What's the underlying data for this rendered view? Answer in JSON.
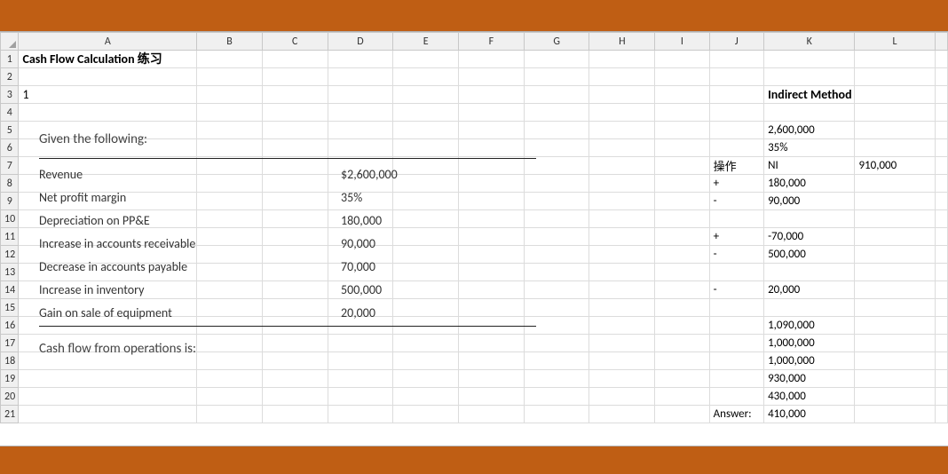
{
  "columns": [
    "A",
    "B",
    "C",
    "D",
    "E",
    "F",
    "G",
    "H",
    "I",
    "J",
    "K",
    "L"
  ],
  "title": "Cash Flow Calculation 练习",
  "heading_num": "1",
  "indirect_label": "Indirect Method",
  "q_heading": "Given the following:",
  "q_rows": [
    {
      "label": "Revenue",
      "value": "$2,600,000"
    },
    {
      "label": "Net profit margin",
      "value": "35%"
    },
    {
      "label": "Depreciation on PP&E",
      "value": "180,000"
    },
    {
      "label": "Increase in accounts receivable",
      "value": "90,000"
    },
    {
      "label": "Decrease in accounts payable",
      "value": "70,000"
    },
    {
      "label": "Increase in inventory",
      "value": "500,000"
    },
    {
      "label": "Gain on sale of equipment",
      "value": "20,000"
    }
  ],
  "q_footer": "Cash flow from operations is:",
  "colJ": {
    "r7": "操作",
    "r8": "+",
    "r9": "-",
    "r11": "+",
    "r12": "-",
    "r14": "-",
    "r21": "Answer:"
  },
  "colK": {
    "r5": "2,600,000",
    "r6": "35%",
    "r7": "NI",
    "r8": "180,000",
    "r9": "90,000",
    "r11": "-70,000",
    "r12": "500,000",
    "r14": "20,000",
    "r16": "1,090,000",
    "r17": "1,000,000",
    "r18": "1,000,000",
    "r19": "930,000",
    "r20": "430,000",
    "r21": "410,000"
  },
  "colL": {
    "r7": "910,000"
  }
}
